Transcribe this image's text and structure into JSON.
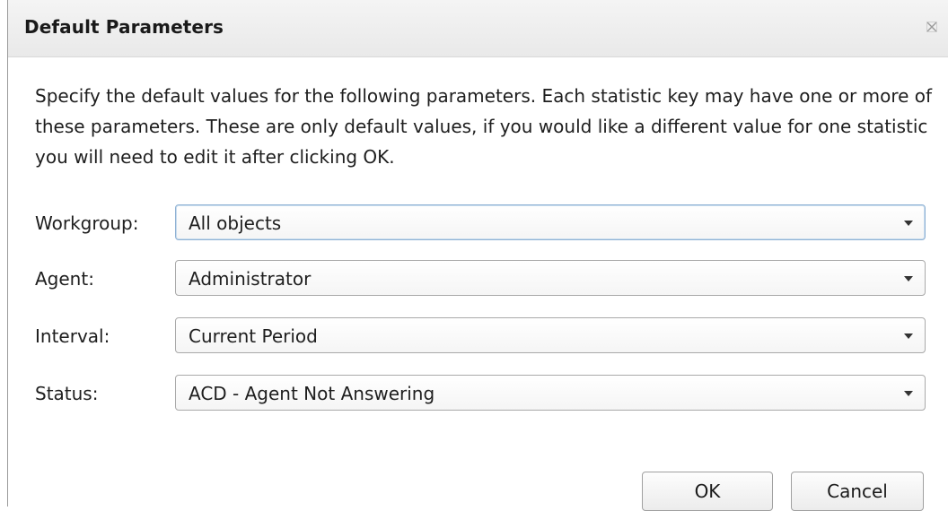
{
  "dialog": {
    "title": "Default Parameters",
    "description": "Specify the default values for the following parameters.  Each statistic key may have one or more of these parameters.  These are only default values, if you would like a different value for one statistic you will need to edit it after clicking OK."
  },
  "fields": {
    "workgroup": {
      "label": "Workgroup:",
      "value": "All objects"
    },
    "agent": {
      "label": "Agent:",
      "value": "Administrator"
    },
    "interval": {
      "label": "Interval:",
      "value": "Current Period"
    },
    "status": {
      "label": "Status:",
      "value": "ACD - Agent Not Answering"
    }
  },
  "buttons": {
    "ok": "OK",
    "cancel": "Cancel"
  },
  "icons": {
    "close": "close-icon",
    "dropdown": "chevron-down-icon"
  }
}
